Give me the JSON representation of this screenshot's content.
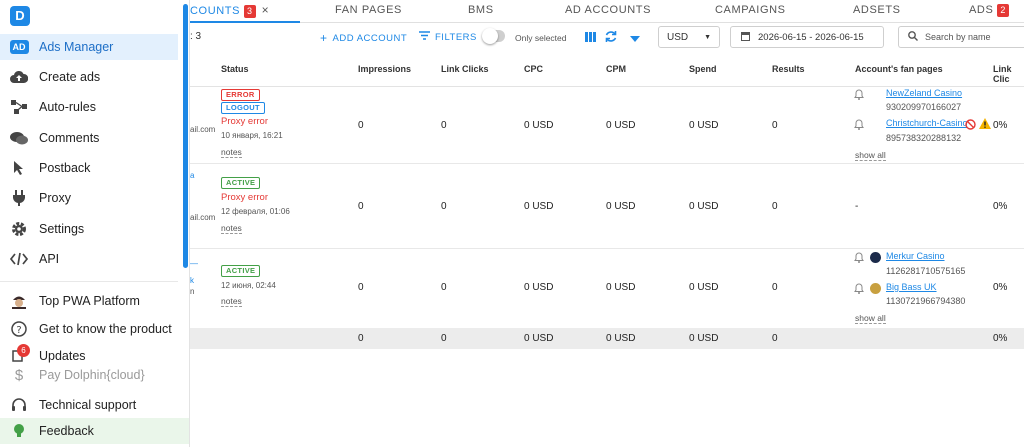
{
  "sidebar": {
    "logo": "D",
    "ad_badge": "AD",
    "items": [
      {
        "label": "Ads Manager"
      },
      {
        "label": "Create ads"
      },
      {
        "label": "Auto-rules"
      },
      {
        "label": "Comments"
      },
      {
        "label": "Postback"
      },
      {
        "label": "Proxy"
      },
      {
        "label": "Settings"
      },
      {
        "label": "API"
      },
      {
        "label": "Top PWA Platform"
      },
      {
        "label": "Get to know the product"
      },
      {
        "label": "Updates"
      },
      {
        "label": "Pay Dolphin{cloud}"
      },
      {
        "label": "Technical support"
      },
      {
        "label": "Feedback"
      }
    ],
    "updates_badge": "6"
  },
  "tabs": {
    "accounts": {
      "label": "COUNTS",
      "count": "3",
      "close": "×"
    },
    "fan_pages": "FAN PAGES",
    "bms": "BMS",
    "ad_accounts": "AD ACCOUNTS",
    "campaigns": "CAMPAIGNS",
    "adsets": "ADSETS",
    "ads": {
      "label": "ADS",
      "count": "2"
    }
  },
  "toolbar": {
    "count_fragment": ": 3",
    "add_account": "ADD ACCOUNT",
    "filters": "FILTERS",
    "only_selected": "Only selected",
    "currency": "USD",
    "date_range": "2026-06-15 - 2026-06-15",
    "search_placeholder": "Search by name"
  },
  "columns": [
    "Status",
    "Impressions",
    "Link Clicks",
    "CPC",
    "CPM",
    "Spend",
    "Results",
    "Account's fan pages",
    "Link Clic"
  ],
  "rows": [
    {
      "frag1": "ail.com",
      "badges": [
        "ERROR",
        "LOGOUT"
      ],
      "error": "Proxy error",
      "date": "10 января, 16:21",
      "notes": "notes",
      "impressions": "0",
      "link_clicks": "0",
      "cpc": "0 USD",
      "cpm": "0 USD",
      "spend": "0 USD",
      "results": "0",
      "pages": [
        {
          "name": "NewZeland Casino",
          "id": "930209970166027"
        },
        {
          "name": "Christchurch-Casino",
          "id": "895738320288132"
        }
      ],
      "show_all": "show all",
      "ctr": "0%"
    },
    {
      "frag_top": "a",
      "frag1": "ail.com",
      "badges": [
        "ACTIVE"
      ],
      "error": "Proxy error",
      "date": "12 февраля, 01:06",
      "notes": "notes",
      "impressions": "0",
      "link_clicks": "0",
      "cpc": "0 USD",
      "cpm": "0 USD",
      "spend": "0 USD",
      "results": "0",
      "pages_empty": "-",
      "ctr": "0%"
    },
    {
      "frag_top": "—",
      "frag_mid": "k",
      "frag1": "n",
      "badges": [
        "ACTIVE"
      ],
      "date": "12 июня, 02:44",
      "notes": "notes",
      "impressions": "0",
      "link_clicks": "0",
      "cpc": "0 USD",
      "cpm": "0 USD",
      "spend": "0 USD",
      "results": "0",
      "pages": [
        {
          "name": "Merkur Casino",
          "id": "1126281710575165"
        },
        {
          "name": "Big Bass UK",
          "id": "1130721966794380"
        }
      ],
      "show_all": "show all",
      "ctr": "0%"
    }
  ],
  "totals": {
    "impressions": "0",
    "link_clicks": "0",
    "cpc": "0 USD",
    "cpm": "0 USD",
    "spend": "0 USD",
    "results": "0",
    "ctr": "0%"
  },
  "colors": {
    "accent": "#1e88e5",
    "error": "#e53935",
    "active": "#43a047"
  }
}
